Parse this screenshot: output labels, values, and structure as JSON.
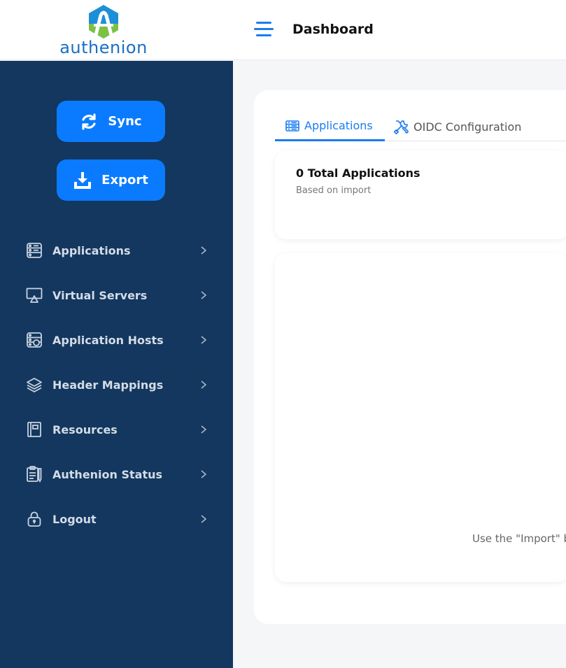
{
  "brand": {
    "name": "authenion"
  },
  "header": {
    "title": "Dashboard",
    "menu_icon": "hamburger-menu-icon"
  },
  "sidebar": {
    "actions": [
      {
        "label": "Sync",
        "icon": "sync-icon"
      },
      {
        "label": "Export",
        "icon": "export-download-icon"
      }
    ],
    "items": [
      {
        "label": "Applications",
        "icon": "applications-icon"
      },
      {
        "label": "Virtual Servers",
        "icon": "virtual-servers-icon"
      },
      {
        "label": "Application Hosts",
        "icon": "application-hosts-icon"
      },
      {
        "label": "Header Mappings",
        "icon": "layers-icon"
      },
      {
        "label": "Resources",
        "icon": "resources-icon"
      },
      {
        "label": "Authenion Status",
        "icon": "clipboard-status-icon"
      },
      {
        "label": "Logout",
        "icon": "lock-icon"
      }
    ]
  },
  "main": {
    "tabs": [
      {
        "label": "Applications",
        "icon": "applications-tab-icon",
        "active": true
      },
      {
        "label": "OIDC Configuration",
        "icon": "tools-icon",
        "active": false
      }
    ],
    "summary": {
      "title": "0 Total Applications",
      "subtitle": "Based on import"
    },
    "empty_message": "Use the \"Import\" b"
  },
  "colors": {
    "sidebar_bg": "#13375f",
    "accent": "#0a7bff",
    "tab_active": "#1a7cf0",
    "page_bg": "#f5f6f8"
  }
}
